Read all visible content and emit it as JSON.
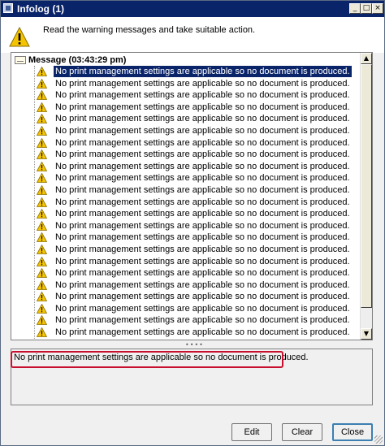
{
  "window": {
    "title": "Infolog (1)"
  },
  "header": {
    "message": "Read the warning messages and take suitable action."
  },
  "tree": {
    "root_label": "Message (03:43:29 pm)",
    "items": [
      "No print management settings are applicable so no document is produced.",
      "No print management settings are applicable so no document is produced.",
      "No print management settings are applicable so no document is produced.",
      "No print management settings are applicable so no document is produced.",
      "No print management settings are applicable so no document is produced.",
      "No print management settings are applicable so no document is produced.",
      "No print management settings are applicable so no document is produced.",
      "No print management settings are applicable so no document is produced.",
      "No print management settings are applicable so no document is produced.",
      "No print management settings are applicable so no document is produced.",
      "No print management settings are applicable so no document is produced.",
      "No print management settings are applicable so no document is produced.",
      "No print management settings are applicable so no document is produced.",
      "No print management settings are applicable so no document is produced.",
      "No print management settings are applicable so no document is produced.",
      "No print management settings are applicable so no document is produced.",
      "No print management settings are applicable so no document is produced.",
      "No print management settings are applicable so no document is produced.",
      "No print management settings are applicable so no document is produced.",
      "No print management settings are applicable so no document is produced.",
      "No print management settings are applicable so no document is produced.",
      "No print management settings are applicable so no document is produced.",
      "No print management settings are applicable so no document is produced.",
      "No print management settings are applicable so no document is produced."
    ]
  },
  "detail": {
    "text": "No print management settings are applicable so no document is produced."
  },
  "buttons": {
    "edit": "Edit",
    "clear": "Clear",
    "close": "Close"
  },
  "colors": {
    "titlebar": "#0a246a",
    "selection": "#0a246a",
    "highlight_box": "#c8102e",
    "warning_yellow": "#f5c400"
  },
  "icons": {
    "app": "window-icon",
    "warning": "warning-triangle-icon",
    "message_root": "envelope-icon"
  }
}
